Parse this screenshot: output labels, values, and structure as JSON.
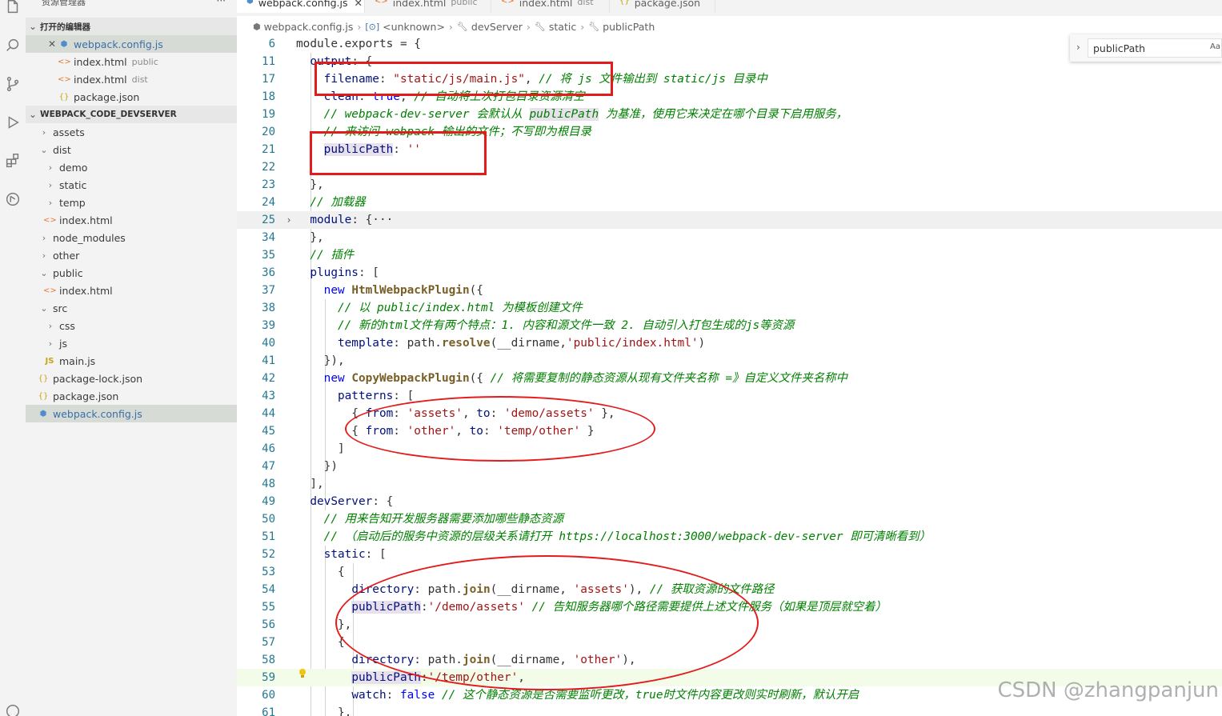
{
  "sidebar": {
    "title": "资源管理器",
    "more": "···",
    "open_editors_title": "打开的编辑器",
    "open_editors": [
      {
        "name": "webpack.config.js",
        "desc": "",
        "icon": "js-config-icon",
        "close": "✕"
      },
      {
        "name": "index.html",
        "desc": "public",
        "icon": "html-icon"
      },
      {
        "name": "index.html",
        "desc": "dist",
        "icon": "html-icon"
      },
      {
        "name": "package.json",
        "desc": "",
        "icon": "json-icon"
      }
    ],
    "project_title": "WEBPACK_CODE_DEVSERVER",
    "tree": [
      {
        "name": "assets"
      },
      {
        "name": "dist"
      },
      {
        "name": "demo"
      },
      {
        "name": "static"
      },
      {
        "name": "temp"
      },
      {
        "name": "index.html"
      },
      {
        "name": "node_modules"
      },
      {
        "name": "other"
      },
      {
        "name": "public"
      },
      {
        "name": "index.html"
      },
      {
        "name": "src"
      },
      {
        "name": "css"
      },
      {
        "name": "js"
      },
      {
        "name": "main.js"
      },
      {
        "name": "package-lock.json"
      },
      {
        "name": "package.json"
      },
      {
        "name": "webpack.config.js"
      }
    ]
  },
  "tabs": [
    {
      "name": "webpack.config.js",
      "desc": "",
      "close": "✕",
      "active": true
    },
    {
      "name": "index.html",
      "desc": "public"
    },
    {
      "name": "index.html",
      "desc": "dist"
    },
    {
      "name": "package.json",
      "desc": ""
    }
  ],
  "breadcrumbs": [
    "webpack.config.js",
    "<unknown>",
    "devServer",
    "static",
    "publicPath"
  ],
  "find": {
    "value": "publicPath",
    "option": "Aa"
  },
  "editor": {
    "line_numbers": [
      "6",
      "11",
      "17",
      "18",
      "19",
      "20",
      "21",
      "22",
      "23",
      "24",
      "25",
      "34",
      "35",
      "36",
      "37",
      "38",
      "39",
      "40",
      "41",
      "42",
      "43",
      "44",
      "45",
      "46",
      "47",
      "48",
      "49",
      "50",
      "51",
      "52",
      "53",
      "54",
      "55",
      "56",
      "57",
      "58",
      "59",
      "60",
      "61"
    ],
    "lines": [
      "module.exports = {",
      "  output: {",
      "    filename: \"static/js/main.js\", // 将 js 文件输出到 static/js 目录中",
      "    clean: true, // 自动将上次打包目录资源清空",
      "    // webpack-dev-server 会默认从 publicPath 为基准，使用它来决定在哪个目录下启用服务，",
      "    // 来访问 webpack 输出的文件；不写即为根目录",
      "    publicPath: ''",
      "",
      "  },",
      "  // 加载器",
      "  module: {···",
      "  },",
      "  // 插件",
      "  plugins: [",
      "    new HtmlWebpackPlugin({",
      "      // 以 public/index.html 为模板创建文件",
      "      // 新的html文件有两个特点：1. 内容和源文件一致 2. 自动引入打包生成的js等资源",
      "      template: path.resolve(__dirname,'public/index.html')",
      "    }),",
      "    new CopyWebpackPlugin({ // 将需要复制的静态资源从现有文件夹名称 =》自定义文件夹名称中",
      "      patterns: [",
      "        { from: 'assets', to: 'demo/assets' },",
      "        { from: 'other', to: 'temp/other' }",
      "      ]",
      "    })",
      "  ],",
      "  devServer: {",
      "    // 用来告知开发服务器需要添加哪些静态资源",
      "    // （启动后的服务中资源的层级关系请打开 https://localhost:3000/webpack-dev-server 即可清晰看到）",
      "    static: [",
      "      {",
      "        directory: path.join(__dirname, 'assets'), // 获取资源的文件路径",
      "        publicPath:'/demo/assets' // 告知服务器哪个路径需要提供上述文件服务（如果是顶层就空着）",
      "      },",
      "      {",
      "        directory: path.join(__dirname, 'other'),",
      "        publicPath:'/temp/other',",
      "        watch: false // 这个静态资源是否需要监听更改，true时文件内容更改则实时刷新，默认开启",
      "      },"
    ]
  },
  "watermark": "CSDN @zhangpanjun",
  "colors": {
    "annotation": "#e31b1b",
    "keyword": "#0000ff",
    "string": "#a31515",
    "comment": "#008000",
    "property": "#001080"
  }
}
